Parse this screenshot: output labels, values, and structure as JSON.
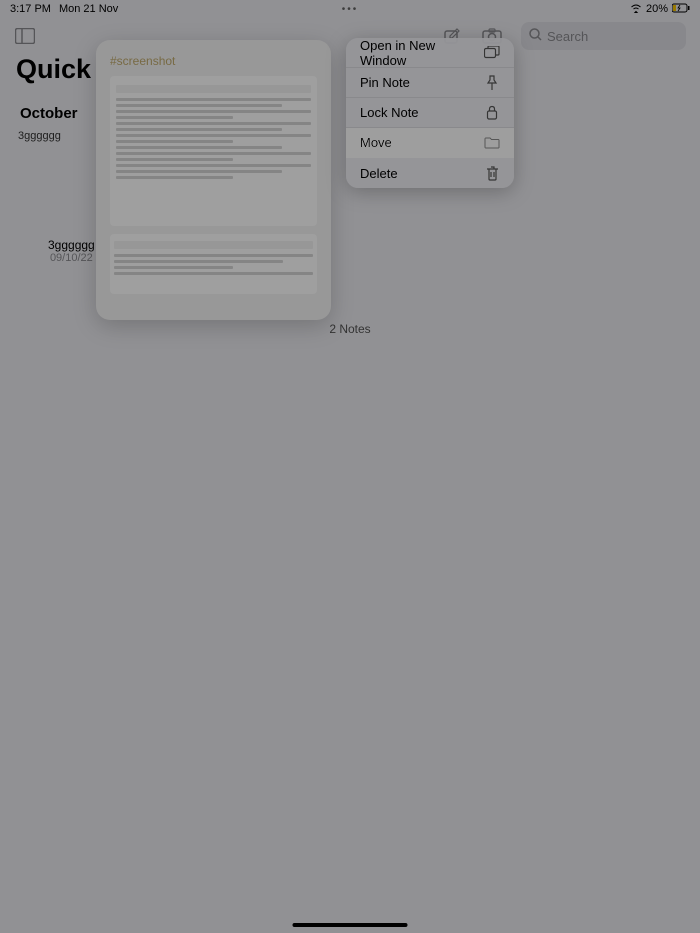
{
  "status": {
    "time": "3:17 PM",
    "date": "Mon 21 Nov",
    "dots": "•••",
    "battery": "20%"
  },
  "toolbar": {
    "search_placeholder": "Search"
  },
  "page": {
    "title": "Quick Notes",
    "section": "October",
    "count": "2 Notes"
  },
  "note_bg": {
    "title": "3gggggg"
  },
  "second_note": {
    "title": "3gggggg",
    "date": "09/10/22"
  },
  "preview": {
    "tag": "#screenshot"
  },
  "menu": {
    "items": [
      {
        "label": "Open in New Window",
        "icon": "window"
      },
      {
        "label": "Pin Note",
        "icon": "pin"
      },
      {
        "label": "Lock Note",
        "icon": "lock"
      },
      {
        "label": "Move",
        "icon": "folder"
      },
      {
        "label": "Delete",
        "icon": "trash"
      }
    ],
    "highlighted_index": 3
  }
}
